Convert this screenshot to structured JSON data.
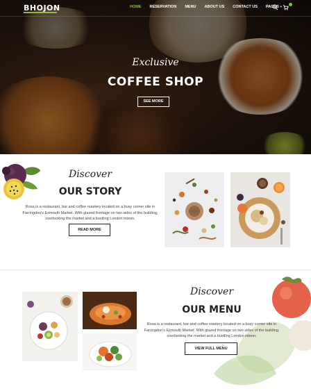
{
  "nav": {
    "logo": "BHOJON",
    "items": [
      "HOME",
      "RESERVATION",
      "MENU",
      "ABOUT US",
      "CONTACT US",
      "PAGES"
    ],
    "active_index": 0,
    "icons": [
      "search-icon",
      "cart-icon"
    ]
  },
  "hero": {
    "kicker": "Exclusive",
    "title": "COFFEE SHOP",
    "button": "SEE MORE"
  },
  "story": {
    "kicker": "Discover",
    "title": "OUR STORY",
    "body": "Rosa is a restaurant, bar and coffee roastery located on a busy corner site in Farringdon's Exmouth Market. With glazed frontage on two sides of the building, overlooking the market and a bustling London inteon.",
    "button": "READ MORE"
  },
  "menu": {
    "kicker": "Discover",
    "title": "OUR MENU",
    "body": "Rosa is a restaurant, bar and coffee roastery located on a busy corner site in Farringdon's Exmouth Market. With glazed frontage on two sides of the building, overlooking the market and a bustling London inteon.",
    "button": "VIEW FULL MENU"
  },
  "colors": {
    "accent": "#8bbf3f",
    "dark": "#222222"
  }
}
